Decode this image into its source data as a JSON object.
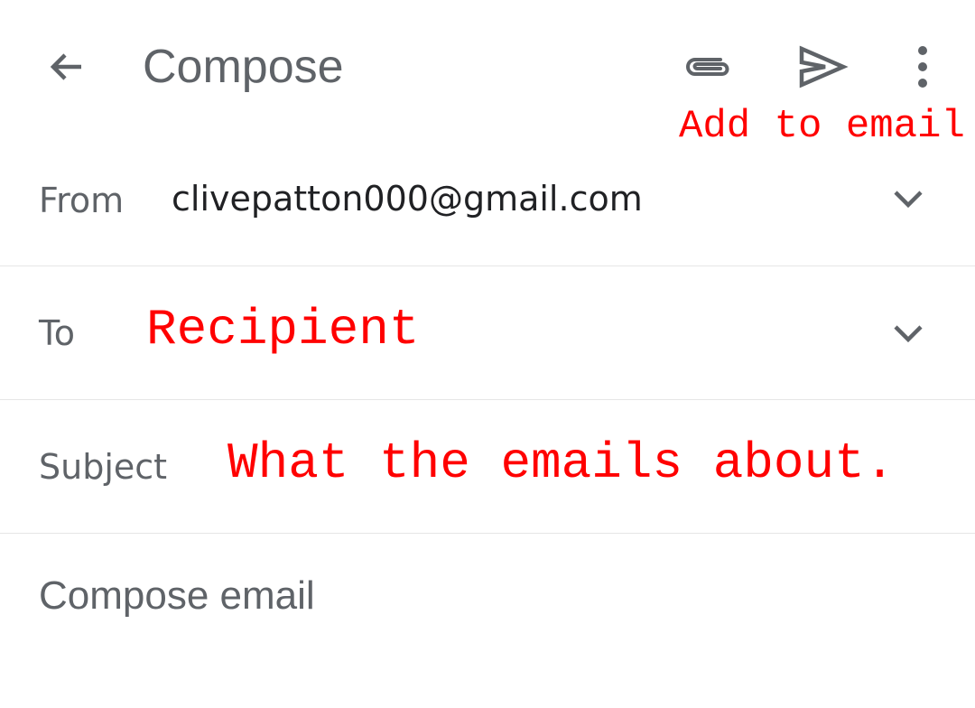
{
  "appbar": {
    "title": "Compose",
    "annotation": "Add to email",
    "icons": {
      "back": "arrow-back-icon",
      "attach": "paperclip-icon",
      "send": "send-icon",
      "more": "more-vert-icon"
    }
  },
  "from": {
    "label": "From",
    "value": "clivepatton000@gmail.com"
  },
  "to": {
    "label": "To",
    "hint": "Recipient"
  },
  "subject": {
    "label": "Subject",
    "hint": "What the emails about."
  },
  "body": {
    "placeholder": "Compose email"
  },
  "colors": {
    "icon_gray": "#5f6368",
    "annotation_red": "#ff0000",
    "divider": "#e6e6e6"
  }
}
